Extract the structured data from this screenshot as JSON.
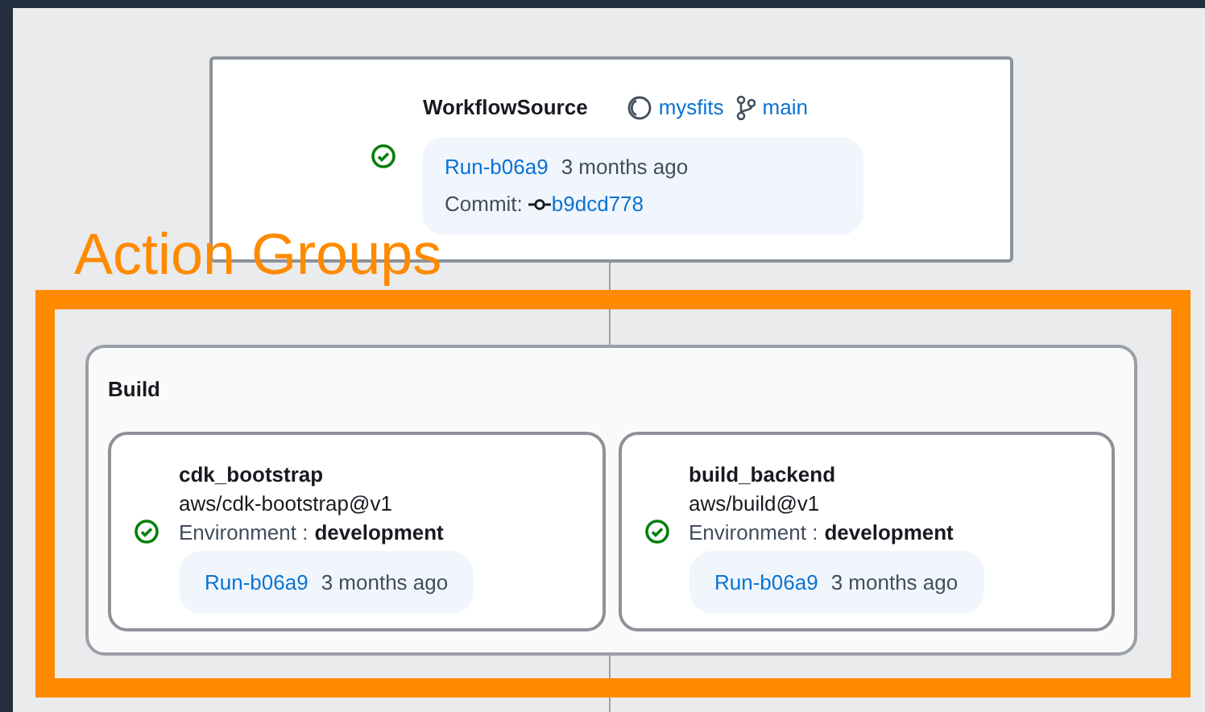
{
  "source": {
    "title": "WorkflowSource",
    "repository": "mysfits",
    "branch": "main",
    "succeeded": true,
    "run": "Run-b06a9",
    "time": "3 months ago",
    "commit_label": "Commit:",
    "commit": "b9dcd778"
  },
  "annotation": {
    "label": "Action Groups"
  },
  "group": {
    "title": "Build",
    "actions": [
      {
        "name": "cdk_bootstrap",
        "action": "aws/cdk-bootstrap@v1",
        "succeeded": true,
        "environment_label": "Environment :",
        "environment": "development",
        "run": "Run-b06a9",
        "time": "3 months ago"
      },
      {
        "name": "build_backend",
        "action": "aws/build@v1",
        "succeeded": true,
        "environment_label": "Environment :",
        "environment": "development",
        "run": "Run-b06a9",
        "time": "3 months ago"
      }
    ]
  }
}
